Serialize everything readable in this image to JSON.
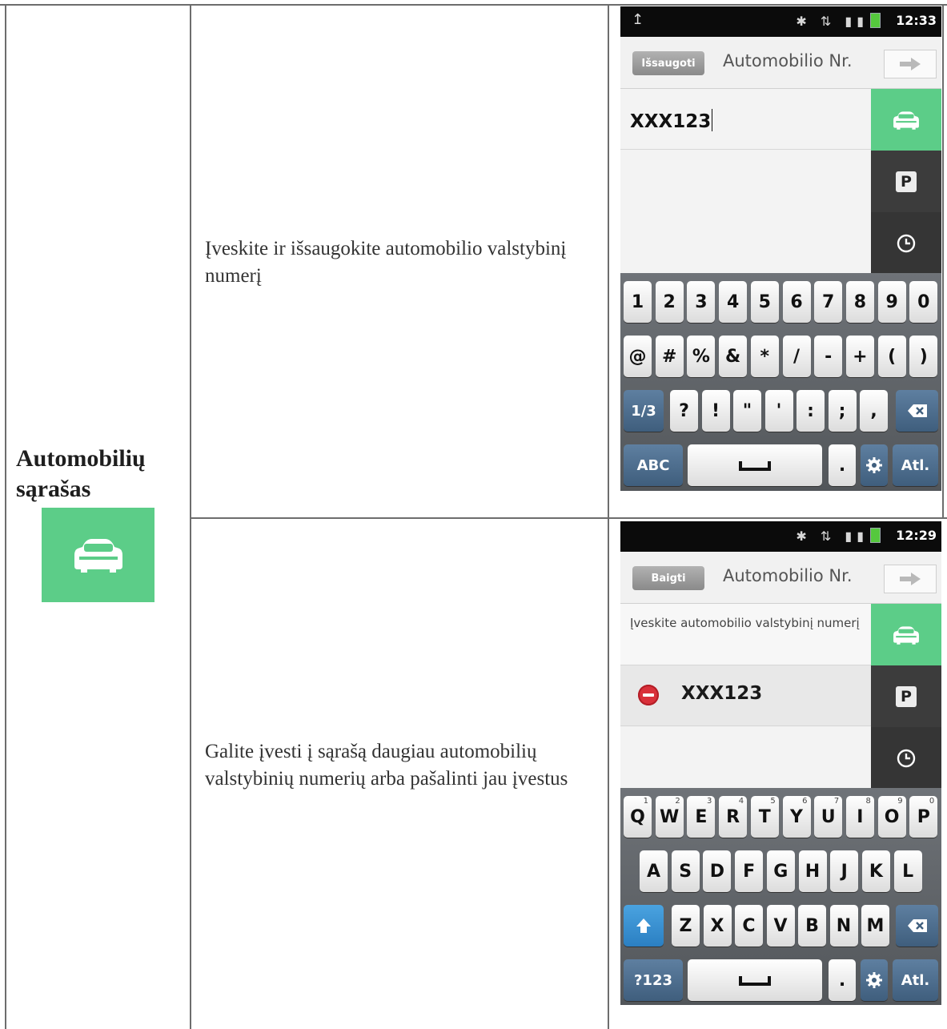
{
  "section": {
    "title_line1": "Automobilių",
    "title_line2": "sąrašas",
    "icon": "car-icon",
    "tile_color": "#5ccd88"
  },
  "rows": [
    {
      "description": "Įveskite ir išsaugokite automobilio valstybinį numerį",
      "phone": {
        "status_time": "12:33",
        "action_button": "Išsaugoti",
        "title": "Automobilio Nr.",
        "input_value": "XXX123",
        "keyboard": {
          "row1": [
            "1",
            "2",
            "3",
            "4",
            "5",
            "6",
            "7",
            "8",
            "9",
            "0"
          ],
          "row2": [
            "@",
            "#",
            "%",
            "&",
            "*",
            "/",
            "-",
            "+",
            "(",
            ")"
          ],
          "row3": [
            "1/3",
            "?",
            "!",
            "\"",
            "'",
            ":",
            ";",
            ","
          ],
          "row4": [
            "ABC",
            ".",
            "Atl."
          ]
        }
      }
    },
    {
      "description": "Galite įvesti į sąrašą daugiau automobilių valstybinių numerių arba pašalinti jau įvestus",
      "phone": {
        "status_time": "12:29",
        "action_button": "Baigti",
        "title": "Automobilio Nr.",
        "input_hint": "Įveskite automobilio valstybinį numerį",
        "list_items": [
          "XXX123"
        ],
        "keyboard": {
          "row1": [
            "Q",
            "W",
            "E",
            "R",
            "T",
            "Y",
            "U",
            "I",
            "O",
            "P"
          ],
          "row1_small": [
            "1",
            "2",
            "3",
            "4",
            "5",
            "6",
            "7",
            "8",
            "9",
            "0"
          ],
          "row2": [
            "A",
            "S",
            "D",
            "F",
            "G",
            "H",
            "J",
            "K",
            "L"
          ],
          "row3": [
            "Z",
            "X",
            "C",
            "V",
            "B",
            "N",
            "M"
          ],
          "row4": [
            "?123",
            ".",
            "Atl."
          ]
        }
      }
    }
  ],
  "rail": {
    "p_label": "P"
  },
  "colors": {
    "green": "#5ccd88",
    "rail_dark": "#3c3c3c",
    "key_dark": "#3f5e7d"
  }
}
